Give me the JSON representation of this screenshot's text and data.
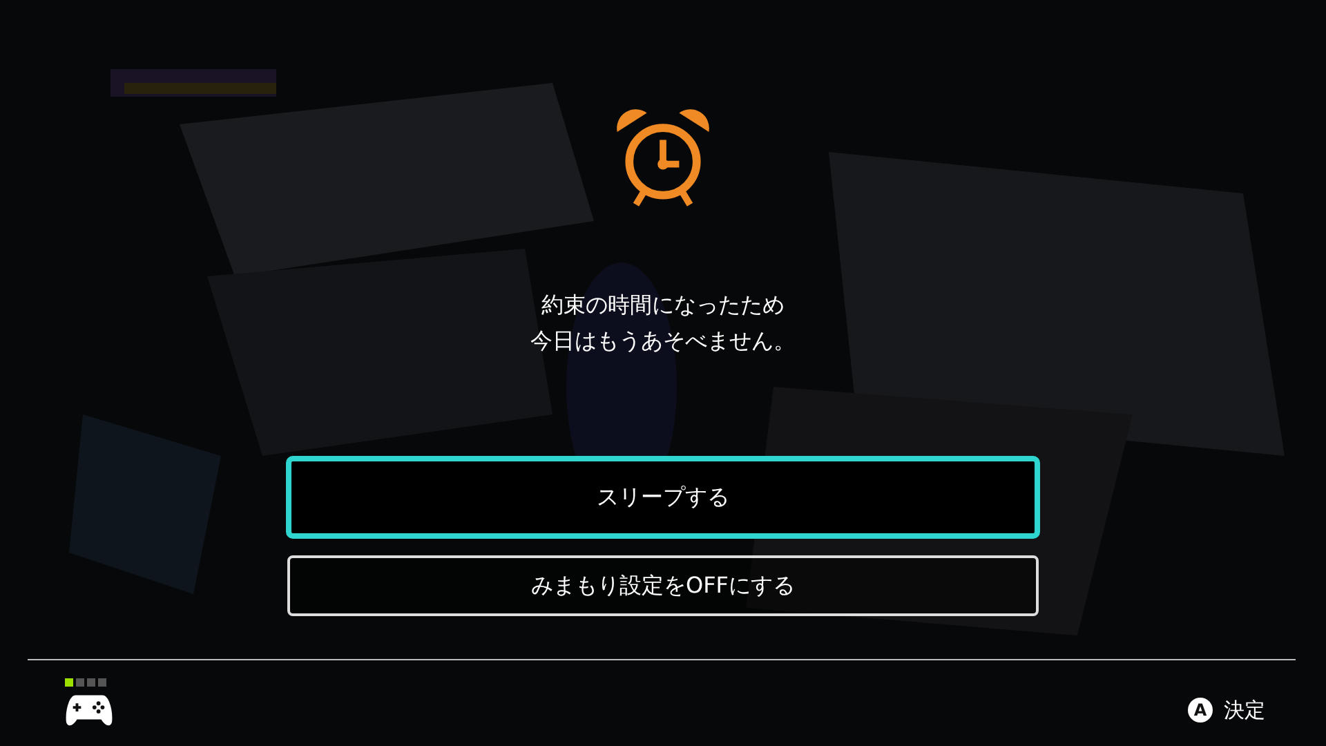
{
  "message_lines": [
    "約束の時間になったため",
    "今日はもうあそべません。"
  ],
  "buttons": [
    {
      "label": "スリープする",
      "selected": true
    },
    {
      "label": "みまもり設定をOFFにする",
      "selected": false
    }
  ],
  "footer": {
    "player_lights": [
      {
        "selected": true
      },
      {
        "selected": false
      },
      {
        "selected": false
      },
      {
        "selected": false
      }
    ],
    "action": {
      "key": "A",
      "label": "決定"
    }
  }
}
